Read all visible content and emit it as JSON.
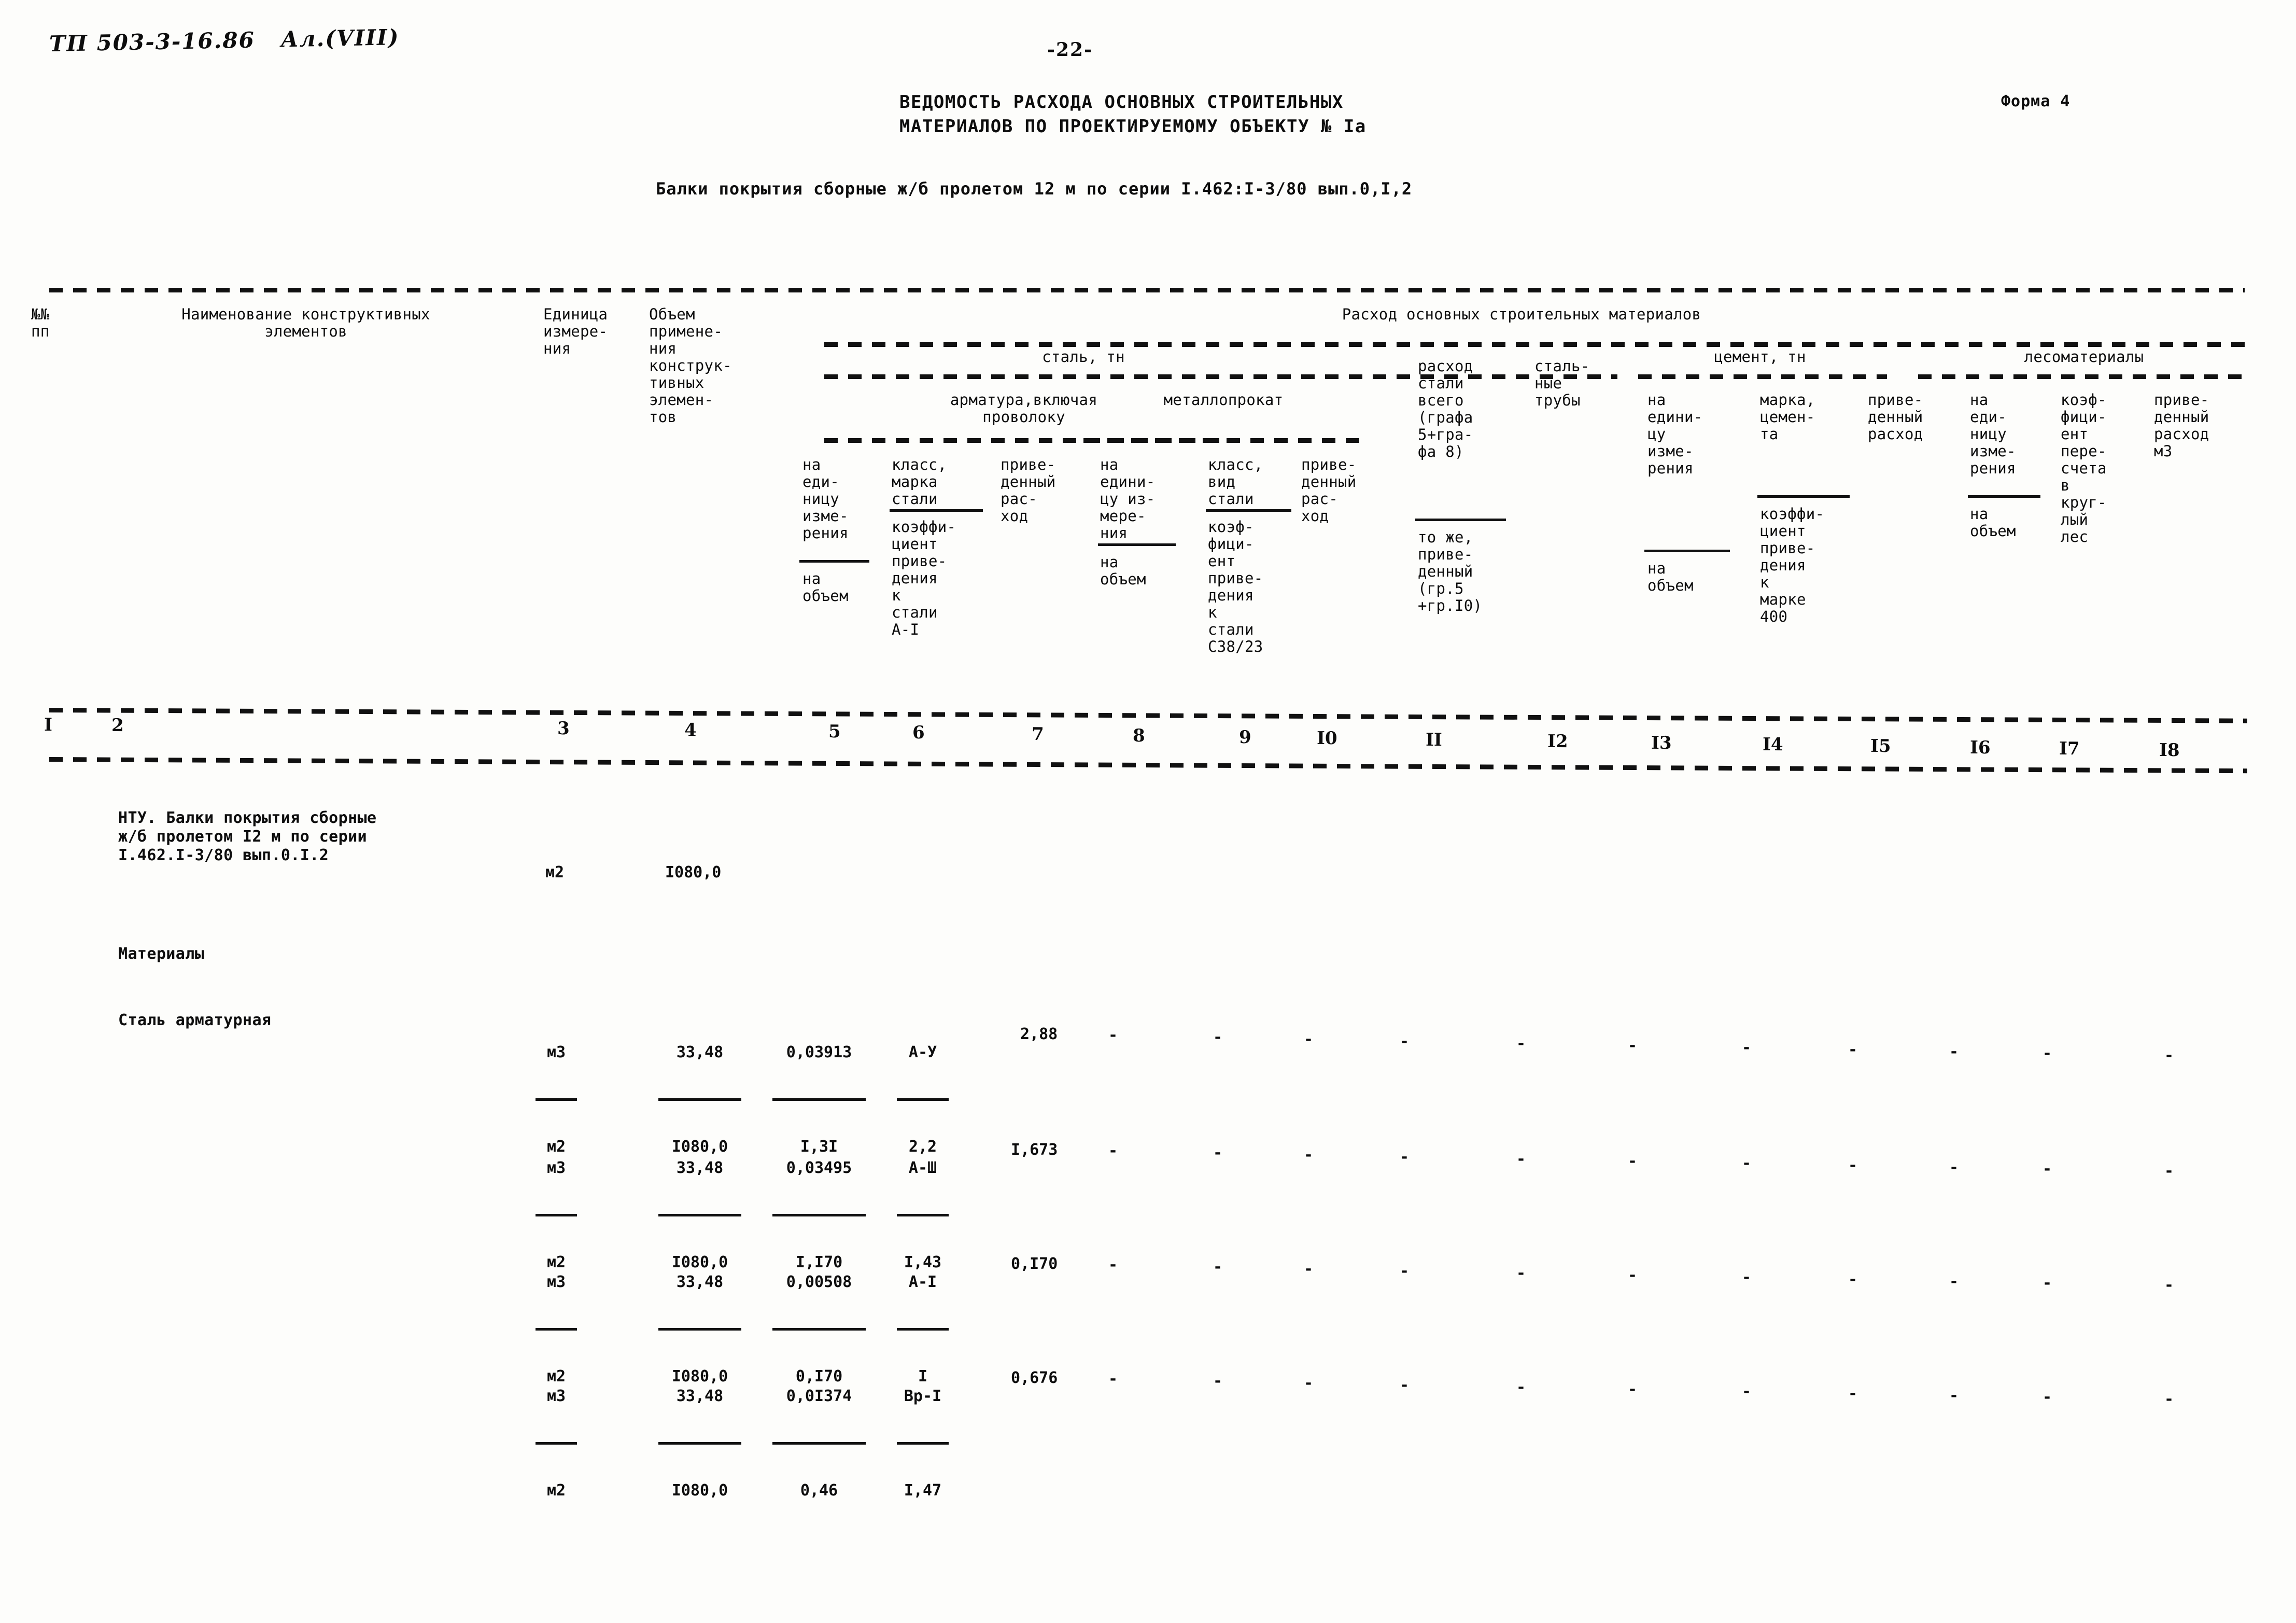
{
  "document": {
    "archive_code": "ТП 503-3-16.86   Ал.(VIII)",
    "page_number": "-22-",
    "form_label": "Форма 4",
    "title_line1": "ВЕДОМОСТЬ РАСХОДА ОСНОВНЫХ СТРОИТЕЛЬНЫХ",
    "title_line2": "МАТЕРИАЛОВ ПО ПРОЕКТИРУЕМОМУ ОБЪЕКТУ № Iа",
    "subtitle": "Балки покрытия сборные ж/б пролетом 12 м по серии I.462:I-3/80 вып.0,I,2"
  },
  "table": {
    "group_headers": {
      "main": "Расход основных строительных материалов",
      "steel": "сталь, тн",
      "rebar": "арматура,включая\nпроволоку",
      "rolled": "металлопрокат",
      "cement": "цемент, тн",
      "timber": "лесоматериалы"
    },
    "columns": [
      {
        "num": "I",
        "label": "№№\nпп"
      },
      {
        "num": "2",
        "label": "Наименование конструктивных\nэлементов"
      },
      {
        "num": "3",
        "label": "Единица\nизмере-\nния"
      },
      {
        "num": "4",
        "label": "Объем\nпримене-\nния\nконструк-\nтивных\nэлемен-\nтов"
      },
      {
        "num": "5",
        "label_top": "на\nеди-\nницу\nизме-\nрения",
        "label_bottom": "на\nобъем"
      },
      {
        "num": "6",
        "label_top": "класс,\nмарка\nстали",
        "label_bottom": "коэффи-\nциент\nприве-\nдения\nк\nстали\nА-I"
      },
      {
        "num": "7",
        "label": "приве-\nденный\nрас-\nход"
      },
      {
        "num": "8",
        "label_top": "на\nедини-\nцу из-\nмере-\nния",
        "label_bottom": "на\nобъем"
      },
      {
        "num": "9",
        "label_top": "класс,\nвид\nстали",
        "label_bottom": "коэф-\nфици-\nент\nприве-\nдения\nк\nстали\nС38/23"
      },
      {
        "num": "I0",
        "label": "приве-\nденный\nрас-\nход"
      },
      {
        "num": "II",
        "label_top": "расход\nстали\nвсего\n(графа\n5+гра-\nфа 8)",
        "label_bottom": "то же,\nприве-\nденный\n(гр.5\n+гр.I0)"
      },
      {
        "num": "I2",
        "label": "сталь-\nные\nтрубы"
      },
      {
        "num": "I3",
        "label_top": "на\nедини-\nцу\nизме-\nрения",
        "label_bottom": "на\nобъем"
      },
      {
        "num": "I4",
        "label_top": "марка,\nцемен-\nта",
        "label_bottom": "коэффи-\nциент\nприве-\nдения\nк\nмарке\n400"
      },
      {
        "num": "I5",
        "label": "приве-\nденный\nрасход"
      },
      {
        "num": "I6",
        "label_top": "на\nеди-\nницу\nизме-\nрения",
        "label_bottom": "на\nобъем"
      },
      {
        "num": "I7",
        "label": "коэф-\nфици-\nент\nпере-\nсчета\nв\nкруг-\nлый\nлес"
      },
      {
        "num": "I8",
        "label": "приве-\nденный\nрасход\nм3"
      }
    ],
    "section_rows": [
      {
        "name": "ntu",
        "text": "НТУ. Балки покрытия сборные\nж/б пролетом I2 м по серии\nI.462.I-3/80 вып.0.I.2",
        "unit": "м2",
        "volume": "I080,0"
      },
      {
        "name": "materials-heading",
        "text": "Материалы"
      },
      {
        "name": "steel-rebar-heading",
        "text": "Сталь арматурная"
      }
    ],
    "data_rows": [
      {
        "unit_num": "м3",
        "unit_den": "м2",
        "vol_num": "33,48",
        "vol_den": "I080,0",
        "c5_num": "0,03913",
        "c5_den": "I,3I",
        "c6_num": "А-У",
        "c6_den": "2,2",
        "c7": "2,88",
        "c8": "-",
        "c9": "-",
        "c10": "-",
        "c11": "-",
        "c12": "-",
        "c13": "-",
        "c14": "-",
        "c15": "-",
        "c16": "-",
        "c17": "-",
        "c18": "-"
      },
      {
        "unit_num": "м3",
        "unit_den": "м2",
        "vol_num": "33,48",
        "vol_den": "I080,0",
        "c5_num": "0,03495",
        "c5_den": "I,I70",
        "c6_num": "А-Ш",
        "c6_den": "I,43",
        "c7": "I,673",
        "c8": "-",
        "c9": "-",
        "c10": "-",
        "c11": "-",
        "c12": "-",
        "c13": "-",
        "c14": "-",
        "c15": "-",
        "c16": "-",
        "c17": "-",
        "c18": "-"
      },
      {
        "unit_num": "м3",
        "unit_den": "м2",
        "vol_num": "33,48",
        "vol_den": "I080,0",
        "c5_num": "0,00508",
        "c5_den": "0,I70",
        "c6_num": "А-I",
        "c6_den": "I",
        "c7": "0,I70",
        "c8": "-",
        "c9": "-",
        "c10": "-",
        "c11": "-",
        "c12": "-",
        "c13": "-",
        "c14": "-",
        "c15": "-",
        "c16": "-",
        "c17": "-",
        "c18": "-"
      },
      {
        "unit_num": "м3",
        "unit_den": "м2",
        "vol_num": "33,48",
        "vol_den": "I080,0",
        "c5_num": "0,0I374",
        "c5_den": "0,46",
        "c6_num": "Вр-I",
        "c6_den": "I,47",
        "c7": "0,676",
        "c8": "-",
        "c9": "-",
        "c10": "-",
        "c11": "-",
        "c12": "-",
        "c13": "-",
        "c14": "-",
        "c15": "-",
        "c16": "-",
        "c17": "-",
        "c18": "-"
      }
    ]
  }
}
